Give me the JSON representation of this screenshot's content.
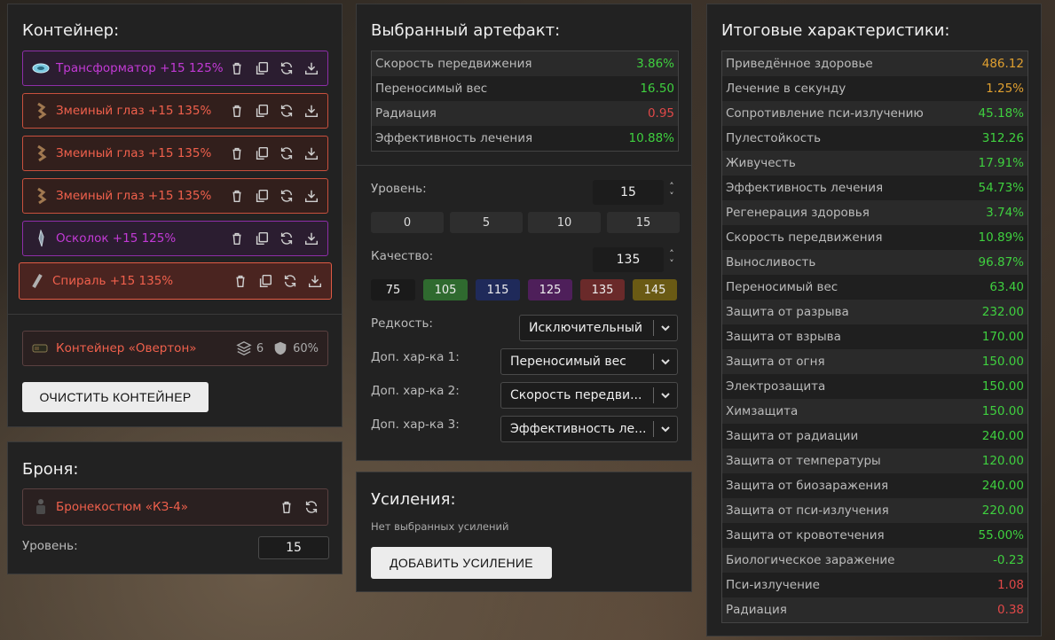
{
  "container_panel": {
    "title": "Контейнер:",
    "artifacts": [
      {
        "name": "Трансформатор +15 125%",
        "rarity": "purple",
        "icon": "transformer-icon"
      },
      {
        "name": "Змеиный глаз +15 135%",
        "rarity": "red",
        "icon": "snake-eye-icon"
      },
      {
        "name": "Змеиный глаз +15 135%",
        "rarity": "red",
        "icon": "snake-eye-icon"
      },
      {
        "name": "Змеиный глаз +15 135%",
        "rarity": "red",
        "icon": "snake-eye-icon"
      },
      {
        "name": "Осколок +15 125%",
        "rarity": "purple",
        "icon": "shard-icon"
      },
      {
        "name": "Спираль +15 135%",
        "rarity": "red",
        "icon": "spiral-icon",
        "selected": true
      }
    ],
    "container": {
      "name": "Контейнер «Овертон»",
      "slots": "6",
      "protection": "60%"
    },
    "clear_button": "ОЧИСТИТЬ КОНТЕЙНЕР"
  },
  "armor_panel": {
    "title": "Броня:",
    "armor_name": "Бронекостюм «КЗ-4»",
    "level_label": "Уровень:",
    "level_value": "15"
  },
  "artifact_panel": {
    "title": "Выбранный артефакт:",
    "stats": [
      {
        "label": "Скорость передвижения",
        "value": "3.86%",
        "color": "green"
      },
      {
        "label": "Переносимый вес",
        "value": "16.50",
        "color": "green"
      },
      {
        "label": "Радиация",
        "value": "0.95",
        "color": "red"
      },
      {
        "label": "Эффективность лечения",
        "value": "10.88%",
        "color": "green"
      }
    ],
    "level_label": "Уровень:",
    "level_value": "15",
    "level_presets": [
      "0",
      "5",
      "10",
      "15"
    ],
    "quality_label": "Качество:",
    "quality_value": "135",
    "quality_presets": [
      {
        "label": "75",
        "color": "#1a1a1a"
      },
      {
        "label": "105",
        "color": "#2f6a2f"
      },
      {
        "label": "115",
        "color": "#1f2a5a"
      },
      {
        "label": "125",
        "color": "#4e1f5a"
      },
      {
        "label": "135",
        "color": "#6a2a2a"
      },
      {
        "label": "145",
        "color": "#6a5a14"
      }
    ],
    "rarity_label": "Редкость:",
    "rarity_value": "Исключительный",
    "extra1_label": "Доп. хар-ка 1:",
    "extra1_value": "Переносимый вес",
    "extra2_label": "Доп. хар-ка 2:",
    "extra2_value": "Скорость передви...",
    "extra3_label": "Доп. хар-ка 3:",
    "extra3_value": "Эффективность ле..."
  },
  "boost_panel": {
    "title": "Усиления:",
    "empty_text": "Нет выбранных усилений",
    "add_button": "ДОБАВИТЬ УСИЛЕНИЕ"
  },
  "totals_panel": {
    "title": "Итоговые характеристики:",
    "stats": [
      {
        "label": "Приведённое здоровье",
        "value": "486.12",
        "color": "orange"
      },
      {
        "label": "Лечение в секунду",
        "value": "1.25%",
        "color": "orange"
      },
      {
        "label": "Сопротивление пси-излучению",
        "value": "45.18%",
        "color": "green"
      },
      {
        "label": "Пулестойкость",
        "value": "312.26",
        "color": "green"
      },
      {
        "label": "Живучесть",
        "value": "17.91%",
        "color": "green"
      },
      {
        "label": "Эффективность лечения",
        "value": "54.73%",
        "color": "green"
      },
      {
        "label": "Регенерация здоровья",
        "value": "3.74%",
        "color": "green"
      },
      {
        "label": "Скорость передвижения",
        "value": "10.89%",
        "color": "green"
      },
      {
        "label": "Выносливость",
        "value": "96.87%",
        "color": "green"
      },
      {
        "label": "Переносимый вес",
        "value": "63.40",
        "color": "green"
      },
      {
        "label": "Защита от разрыва",
        "value": "232.00",
        "color": "green"
      },
      {
        "label": "Защита от взрыва",
        "value": "170.00",
        "color": "green"
      },
      {
        "label": "Защита от огня",
        "value": "150.00",
        "color": "green"
      },
      {
        "label": "Электрозащита",
        "value": "150.00",
        "color": "green"
      },
      {
        "label": "Химзащита",
        "value": "150.00",
        "color": "green"
      },
      {
        "label": "Защита от радиации",
        "value": "240.00",
        "color": "green"
      },
      {
        "label": "Защита от температуры",
        "value": "120.00",
        "color": "green"
      },
      {
        "label": "Защита от биозаражения",
        "value": "240.00",
        "color": "green"
      },
      {
        "label": "Защита от пси-излучения",
        "value": "220.00",
        "color": "green"
      },
      {
        "label": "Защита от кровотечения",
        "value": "55.00%",
        "color": "green"
      },
      {
        "label": "Биологическое заражение",
        "value": "-0.23",
        "color": "green"
      },
      {
        "label": "Пси-излучение",
        "value": "1.08",
        "color": "red"
      },
      {
        "label": "Радиация",
        "value": "0.38",
        "color": "red"
      }
    ]
  }
}
